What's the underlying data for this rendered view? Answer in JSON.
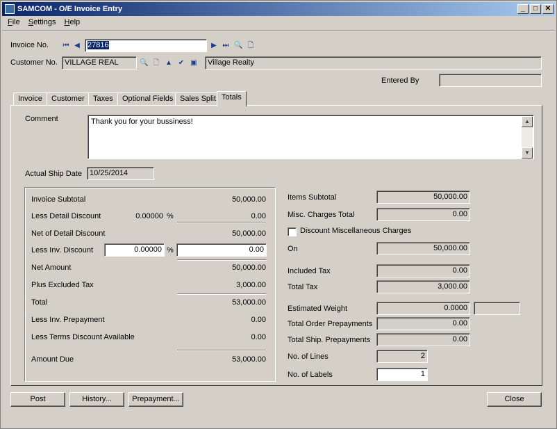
{
  "window": {
    "title": "SAMCOM - O/E Invoice Entry"
  },
  "menu": [
    "File",
    "Settings",
    "Help"
  ],
  "header": {
    "invoice_label": "Invoice No.",
    "invoice_value": "27816",
    "customer_label": "Customer No.",
    "customer_value": "VILLAGE REAL",
    "customer_name": "Village Realty",
    "entered_by_label": "Entered By",
    "entered_by_value": ""
  },
  "tabs": [
    "Invoice",
    "Customer",
    "Taxes",
    "Optional Fields",
    "Sales Split",
    "Totals"
  ],
  "totals": {
    "comment_label": "Comment",
    "comment_value": "Thank you for your bussiness!",
    "ship_date_label": "Actual Ship Date",
    "ship_date_value": "10/25/2014",
    "left": {
      "invoice_subtotal_label": "Invoice Subtotal",
      "invoice_subtotal": "50,000.00",
      "less_detail_discount_label": "Less Detail Discount",
      "detail_discount_pct": "0.00000",
      "pct_symbol": "%",
      "detail_discount_amt": "0.00",
      "net_detail_label": "Net of Detail Discount",
      "net_detail": "50,000.00",
      "less_inv_discount_label": "Less Inv. Discount",
      "inv_discount_pct": "0.00000",
      "inv_discount_amt": "0.00",
      "net_amount_label": "Net Amount",
      "net_amount": "50,000.00",
      "plus_excluded_tax_label": "Plus Excluded Tax",
      "plus_excluded_tax": "3,000.00",
      "total_label": "Total",
      "total": "53,000.00",
      "less_prepayment_label": "Less Inv. Prepayment",
      "less_prepayment": "0.00",
      "less_terms_label": "Less Terms Discount Available",
      "less_terms": "0.00",
      "amount_due_label": "Amount Due",
      "amount_due": "53,000.00"
    },
    "right": {
      "items_subtotal_label": "Items Subtotal",
      "items_subtotal": "50,000.00",
      "misc_charges_label": "Misc. Charges Total",
      "misc_charges": "0.00",
      "discount_misc_label": "Discount Miscellaneous Charges",
      "discount_misc_checked": false,
      "on_label": "On",
      "on_value": "50,000.00",
      "included_tax_label": "Included Tax",
      "included_tax": "0.00",
      "total_tax_label": "Total Tax",
      "total_tax": "3,000.00",
      "est_weight_label": "Estimated Weight",
      "est_weight": "0.0000",
      "est_weight_unit": "",
      "total_order_prepay_label": "Total Order Prepayments",
      "total_order_prepay": "0.00",
      "total_ship_prepay_label": "Total Ship. Prepayments",
      "total_ship_prepay": "0.00",
      "num_lines_label": "No. of Lines",
      "num_lines": "2",
      "num_labels_label": "No. of Labels",
      "num_labels": "1"
    }
  },
  "buttons": {
    "post": "Post",
    "history": "History...",
    "prepayment": "Prepayment...",
    "close": "Close"
  }
}
